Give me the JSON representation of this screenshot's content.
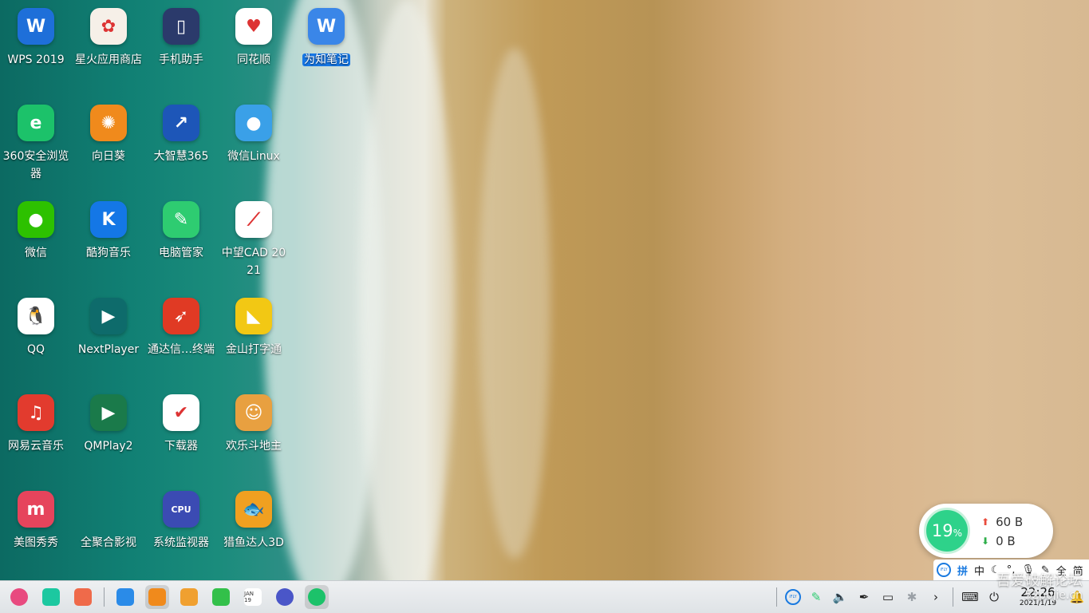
{
  "desktop": {
    "icons": [
      {
        "id": "wps",
        "label": "WPS 2019",
        "color": "#1e6fd9",
        "glyph": "W"
      },
      {
        "id": "spark-store",
        "label": "星火应用商店",
        "color": "#f6f0e8",
        "glyph": "✿"
      },
      {
        "id": "phone-assistant",
        "label": "手机助手",
        "color": "#2b3a6b",
        "glyph": "▯"
      },
      {
        "id": "tonghuashun",
        "label": "同花顺",
        "color": "#ffffff",
        "glyph": "♥"
      },
      {
        "id": "wiz-note",
        "label": "为知笔记",
        "color": "#3a86e8",
        "glyph": "W",
        "selected": true
      },
      {
        "id": "360-browser",
        "label": "360安全浏览器",
        "color": "#1cc26a",
        "glyph": "e"
      },
      {
        "id": "sunflower",
        "label": "向日葵",
        "color": "#f08a1c",
        "glyph": "✺"
      },
      {
        "id": "dzh365",
        "label": "大智慧365",
        "color": "#1d56b8",
        "glyph": "↗"
      },
      {
        "id": "wechat-linux",
        "label": "微信Linux",
        "color": "#3aa0e8",
        "glyph": "●"
      },
      {
        "id": "wechat",
        "label": "微信",
        "color": "#2dc100",
        "glyph": "●"
      },
      {
        "id": "kugou",
        "label": "酷狗音乐",
        "color": "#1477e6",
        "glyph": "K"
      },
      {
        "id": "pc-manager",
        "label": "电脑管家",
        "color": "#2ecc71",
        "glyph": "✎"
      },
      {
        "id": "zwcad",
        "label": "中望CAD 2021",
        "color": "#ffffff",
        "glyph": "⟋"
      },
      {
        "id": "qq",
        "label": "QQ",
        "color": "#ffffff",
        "glyph": "🐧"
      },
      {
        "id": "nextplayer",
        "label": "NextPlayer",
        "color": "#0e6b6b",
        "glyph": "▶"
      },
      {
        "id": "tdx",
        "label": "通达信…终端",
        "color": "#e03a24",
        "glyph": "➶"
      },
      {
        "id": "kingsoft-typing",
        "label": "金山打字通",
        "color": "#f2c814",
        "glyph": "◣"
      },
      {
        "id": "netease-music",
        "label": "网易云音乐",
        "color": "#e23b2e",
        "glyph": "♫"
      },
      {
        "id": "qmplay2",
        "label": "QMPlay2",
        "color": "#1a7a4a",
        "glyph": "▶"
      },
      {
        "id": "downloader",
        "label": "下载器",
        "color": "#ffffff",
        "glyph": "✔"
      },
      {
        "id": "happy-landlord",
        "label": "欢乐斗地主",
        "color": "#e8a040",
        "glyph": "☺"
      },
      {
        "id": "meitu",
        "label": "美图秀秀",
        "color": "#e6445c",
        "glyph": "m"
      },
      {
        "id": "quanjuhe",
        "label": "全聚合影视",
        "color": "rgba(0,0,0,0)",
        "glyph": ""
      },
      {
        "id": "system-monitor",
        "label": "系统监视器",
        "color": "#3b4bb3",
        "glyph": "CPU"
      },
      {
        "id": "fishing3d",
        "label": "猎鱼达人3D",
        "color": "#f0a020",
        "glyph": "🐟"
      }
    ]
  },
  "taskbar": {
    "left_items": [
      {
        "id": "launcher",
        "icon": "launcher-icon",
        "color": "#e84a7f"
      },
      {
        "id": "multitask",
        "icon": "multitask-view-icon",
        "color": "#1cc8a0"
      },
      {
        "id": "show-desktop",
        "icon": "show-desktop-icon",
        "color": "#ef6a4a"
      },
      {
        "id": "file-manager",
        "icon": "file-manager-icon",
        "color": "#2a8be8"
      },
      {
        "id": "app-store",
        "icon": "app-store-icon",
        "color": "#f08a1c",
        "active": true
      },
      {
        "id": "image-viewer",
        "icon": "image-viewer-icon",
        "color": "#f0a030"
      },
      {
        "id": "music",
        "icon": "music-icon",
        "color": "#33c04a"
      },
      {
        "id": "calendar",
        "icon": "calendar-icon",
        "color": "#ffffff",
        "text": "JAN 19"
      },
      {
        "id": "settings",
        "icon": "settings-icon",
        "color": "#4a56c8"
      },
      {
        "id": "360-browser",
        "icon": "browser-icon",
        "color": "#1cc26a",
        "active": true
      }
    ],
    "tray": {
      "ime_badge": "iFLY",
      "clock_time": "22:26",
      "clock_date": "2021/1/19"
    }
  },
  "net_widget": {
    "cpu_value": "19",
    "cpu_unit": "%",
    "upload": "60 B",
    "download": "0 B"
  },
  "ime_bar": {
    "logo": "iFLY",
    "items": [
      "拼",
      "中",
      "全",
      "简"
    ]
  },
  "watermark": {
    "line1": "吾爱破解论坛",
    "line2": "52pojie.cn"
  }
}
